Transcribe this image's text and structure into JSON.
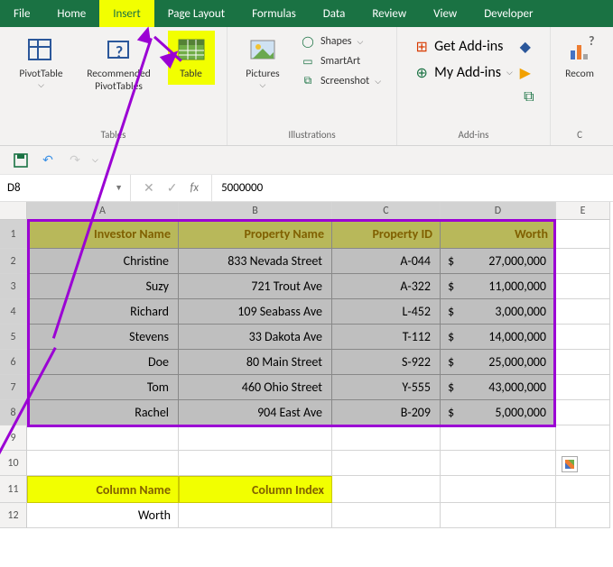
{
  "menu": {
    "file": "File",
    "home": "Home",
    "insert": "Insert",
    "pagelayout": "Page Layout",
    "formulas": "Formulas",
    "data": "Data",
    "review": "Review",
    "view": "View",
    "developer": "Developer"
  },
  "ribbon": {
    "tables_group": "Tables",
    "pivottable": "PivotTable",
    "rec_pivot_l1": "Recommended",
    "rec_pivot_l2": "PivotTables",
    "table": "Table",
    "illustrations_group": "Illustrations",
    "pictures": "Pictures",
    "shapes": "Shapes",
    "smartart": "SmartArt",
    "screenshot": "Screenshot",
    "addins_group": "Add-ins",
    "get_addins": "Get Add-ins",
    "my_addins": "My Add-ins",
    "recommended_l1": "Recom",
    "recommended_l2": "C"
  },
  "namebox": "D8",
  "formula": "5000000",
  "headers": {
    "A": "Investor Name",
    "B": "Property Name",
    "C": "Property ID",
    "D": "Worth"
  },
  "rows": [
    {
      "A": "Christine",
      "B": "833 Nevada Street",
      "C": "A-044",
      "D": "27,000,000"
    },
    {
      "A": "Suzy",
      "B": "721 Trout Ave",
      "C": "A-322",
      "D": "11,000,000"
    },
    {
      "A": "Richard",
      "B": "109 Seabass Ave",
      "C": "L-452",
      "D": "3,000,000"
    },
    {
      "A": "Stevens",
      "B": "33 Dakota Ave",
      "C": "T-112",
      "D": "14,000,000"
    },
    {
      "A": "Doe",
      "B": "80 Main Street",
      "C": "S-922",
      "D": "25,000,000"
    },
    {
      "A": "Tom",
      "B": "460 Ohio Street",
      "C": "Y-555",
      "D": "43,000,000"
    },
    {
      "A": "Rachel",
      "B": "904 East Ave",
      "C": "B-209",
      "D": "5,000,000"
    }
  ],
  "dollar": "$",
  "lower": {
    "col_name": "Column Name",
    "col_index": "Column Index",
    "worth_label": "Worth"
  },
  "colletters": {
    "A": "A",
    "B": "B",
    "C": "C",
    "D": "D",
    "E": "E"
  },
  "rownums": [
    "1",
    "2",
    "3",
    "4",
    "5",
    "6",
    "7",
    "8",
    "9",
    "10",
    "11",
    "12"
  ]
}
